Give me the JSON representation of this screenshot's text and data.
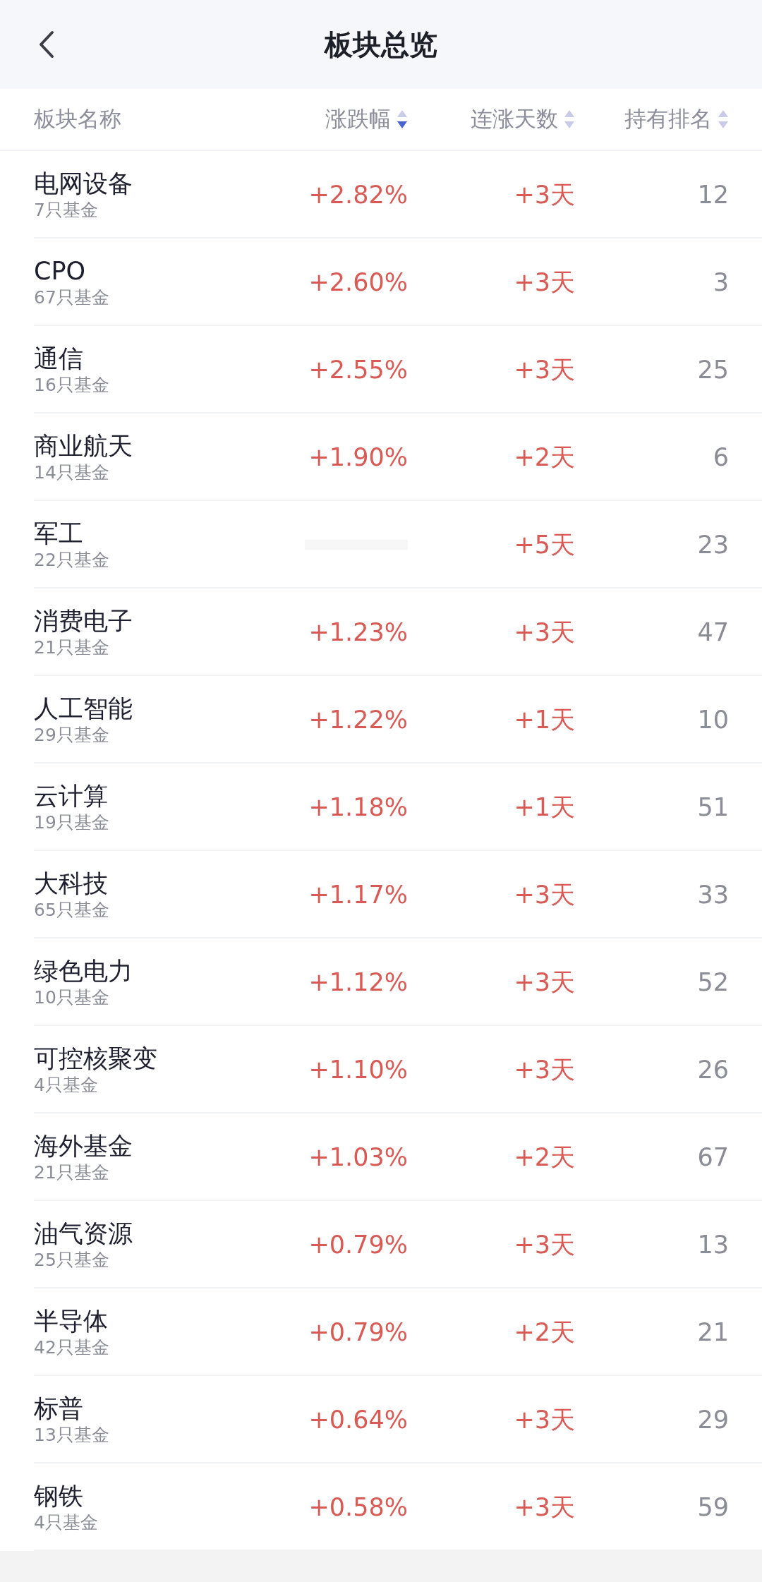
{
  "header": {
    "title": "板块总览"
  },
  "columns": [
    {
      "label": "板块名称"
    },
    {
      "label": "涨跌幅",
      "selected": true
    },
    {
      "label": "连涨天数",
      "selected": false
    },
    {
      "label": "持有排名",
      "selected": false
    }
  ],
  "rows": [
    {
      "name": "电网设备",
      "funds": "7只基金",
      "change": "+2.82%",
      "streak": "+3天",
      "rank": "12"
    },
    {
      "name": "CPO",
      "funds": "67只基金",
      "change": "+2.60%",
      "streak": "+3天",
      "rank": "3"
    },
    {
      "name": "通信",
      "funds": "16只基金",
      "change": "+2.55%",
      "streak": "+3天",
      "rank": "25"
    },
    {
      "name": "商业航天",
      "funds": "14只基金",
      "change": "+1.90%",
      "streak": "+2天",
      "rank": "6"
    },
    {
      "name": "军工",
      "funds": "22只基金",
      "streak": "+5天",
      "rank": "23"
    },
    {
      "name": "消费电子",
      "funds": "21只基金",
      "change": "+1.23%",
      "streak": "+3天",
      "rank": "47"
    },
    {
      "name": "人工智能",
      "funds": "29只基金",
      "change": "+1.22%",
      "streak": "+1天",
      "rank": "10"
    },
    {
      "name": "云计算",
      "funds": "19只基金",
      "change": "+1.18%",
      "streak": "+1天",
      "rank": "51"
    },
    {
      "name": "大科技",
      "funds": "65只基金",
      "change": "+1.17%",
      "streak": "+3天",
      "rank": "33"
    },
    {
      "name": "绿色电力",
      "funds": "10只基金",
      "change": "+1.12%",
      "streak": "+3天",
      "rank": "52"
    },
    {
      "name": "可控核聚变",
      "funds": "4只基金",
      "change": "+1.10%",
      "streak": "+3天",
      "rank": "26"
    },
    {
      "name": "海外基金",
      "funds": "21只基金",
      "change": "+1.03%",
      "streak": "+2天",
      "rank": "67"
    },
    {
      "name": "油气资源",
      "funds": "25只基金",
      "change": "+0.79%",
      "streak": "+3天",
      "rank": "13"
    },
    {
      "name": "半导体",
      "funds": "42只基金",
      "change": "+0.79%",
      "streak": "+2天",
      "rank": "21"
    },
    {
      "name": "标普",
      "funds": "13只基金",
      "change": "+0.64%",
      "streak": "+3天",
      "rank": "29"
    },
    {
      "name": "钢铁",
      "funds": "4只基金",
      "change": "+0.58%",
      "streak": "+3天",
      "rank": "59"
    }
  ]
}
